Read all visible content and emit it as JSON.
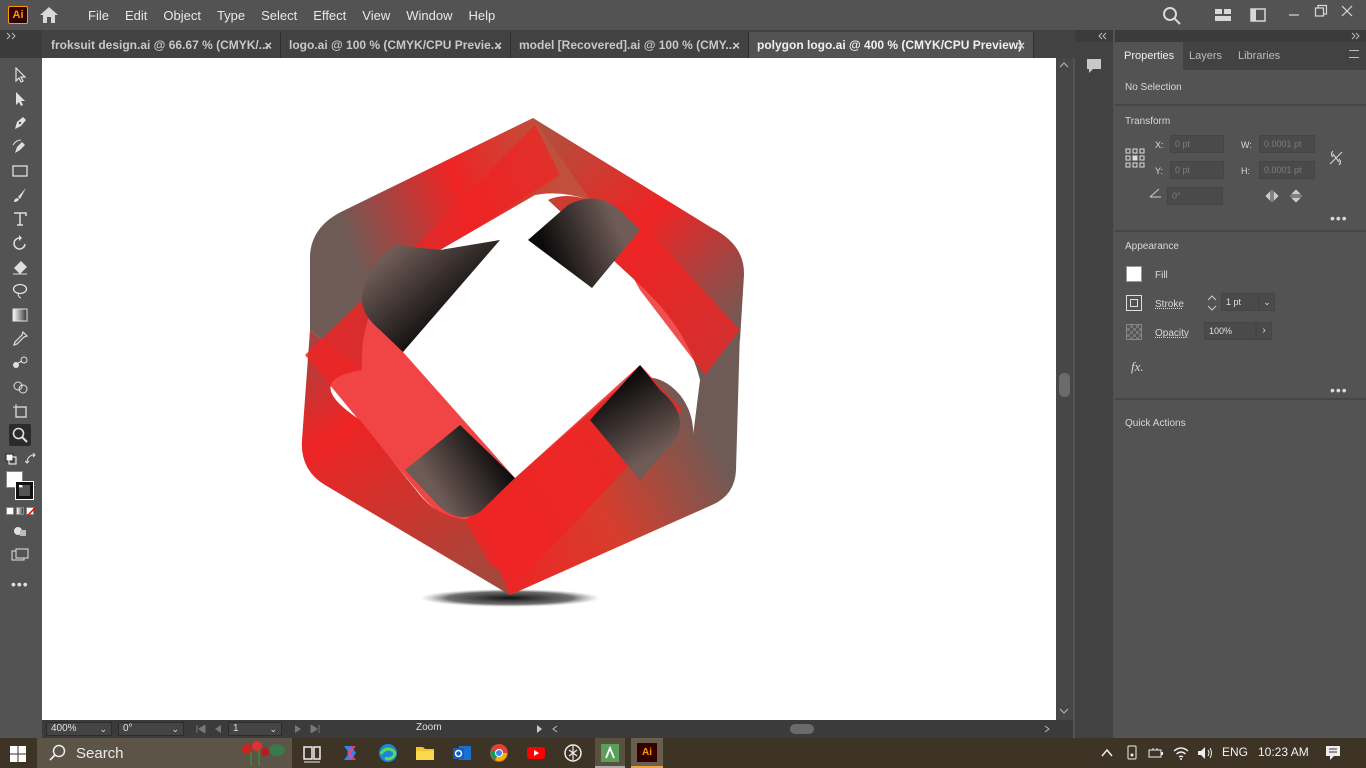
{
  "app": {
    "logo": "Ai",
    "menus": [
      "File",
      "Edit",
      "Object",
      "Type",
      "Select",
      "Effect",
      "View",
      "Window",
      "Help"
    ]
  },
  "tabs": [
    {
      "label": "froksuit design.ai @ 66.67 % (CMYK/...",
      "active": false
    },
    {
      "label": "logo.ai @ 100 % (CMYK/CPU Previe...",
      "active": false
    },
    {
      "label": "model [Recovered].ai @ 100 % (CMY...",
      "active": false
    },
    {
      "label": "polygon logo.ai @ 400 % (CMYK/CPU Preview)",
      "active": true
    }
  ],
  "tab_close": "×",
  "statusbar": {
    "zoom": "400%",
    "rotation": "0°",
    "artboard": "1",
    "tool_name": "Zoom"
  },
  "panel": {
    "tabs": [
      "Properties",
      "Layers",
      "Libraries"
    ],
    "selection": "No Selection",
    "transform": {
      "title": "Transform",
      "x_label": "X:",
      "x_value": "0 pt",
      "y_label": "Y:",
      "y_value": "0 pt",
      "w_label": "W:",
      "w_value": "0.0001 pt",
      "h_label": "H:",
      "h_value": "0.0001 pt",
      "angle_value": "0°"
    },
    "appearance": {
      "title": "Appearance",
      "fill_label": "Fill",
      "stroke_label": "Stroke",
      "stroke_value": "1 pt",
      "opacity_label": "Opacity",
      "opacity_value": "100%",
      "fx_label": "fx."
    },
    "quick_actions": "Quick Actions"
  },
  "taskbar": {
    "search": "Search",
    "lang": "ENG",
    "time": "10:23 AM"
  },
  "colors": {
    "logo_red": "#ee2424",
    "logo_gray": "#6e5b56",
    "accent_orange": "#ff9a00"
  }
}
